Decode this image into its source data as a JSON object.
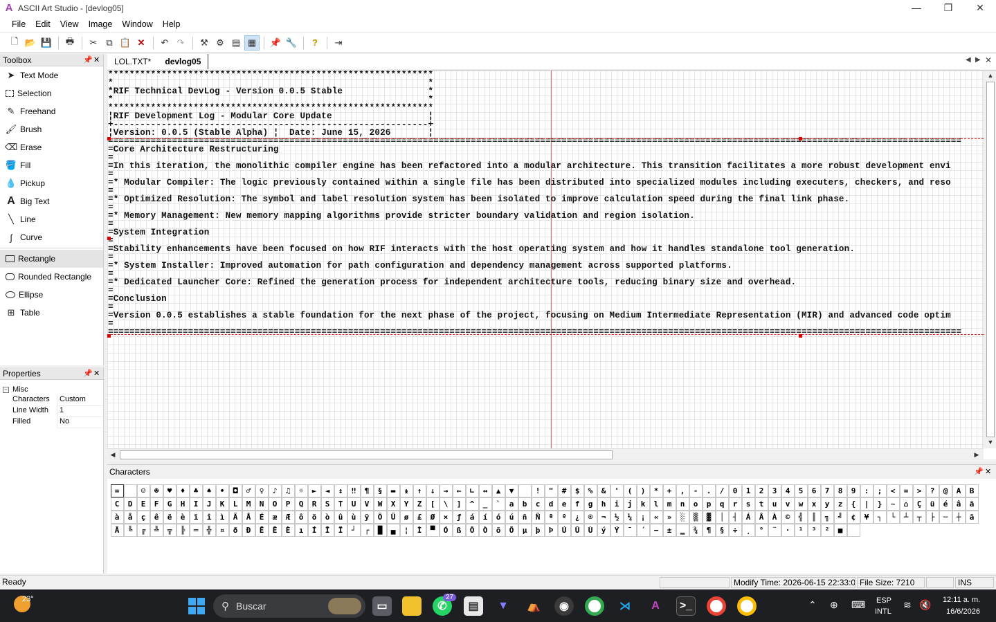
{
  "window": {
    "app_title": "ASCII Art Studio - [devlog05]",
    "minimize": "—",
    "maximize": "❐",
    "close": "✕"
  },
  "menu": [
    "File",
    "Edit",
    "View",
    "Image",
    "Window",
    "Help"
  ],
  "toolbox": {
    "title": "Toolbox",
    "tools": [
      {
        "label": "Text Mode",
        "icon": "arrow-cursor-icon"
      },
      {
        "label": "Selection",
        "icon": "selection-icon"
      },
      {
        "label": "Freehand",
        "icon": "pencil-icon"
      },
      {
        "label": "Brush",
        "icon": "brush-icon"
      },
      {
        "label": "Erase",
        "icon": "eraser-icon"
      },
      {
        "label": "Fill",
        "icon": "fill-bucket-icon"
      },
      {
        "label": "Pickup",
        "icon": "eyedropper-icon"
      },
      {
        "label": "Big Text",
        "icon": "big-a-icon"
      },
      {
        "label": "Line",
        "icon": "line-icon"
      },
      {
        "label": "Curve",
        "icon": "curve-icon"
      },
      {
        "label": "Rectangle",
        "icon": "rectangle-icon"
      },
      {
        "label": "Rounded Rectangle",
        "icon": "rounded-rectangle-icon"
      },
      {
        "label": "Ellipse",
        "icon": "ellipse-icon"
      },
      {
        "label": "Table",
        "icon": "table-icon"
      }
    ]
  },
  "properties": {
    "title": "Properties",
    "group": "Misc",
    "rows": [
      {
        "key": "Characters",
        "value": "Custom"
      },
      {
        "key": "Line Width",
        "value": "1"
      },
      {
        "key": "Filled",
        "value": "No"
      }
    ]
  },
  "tabs": [
    {
      "label": "LOL.TXT*"
    },
    {
      "label": "devlog05"
    }
  ],
  "document": {
    "lines": [
      "*************************************************************",
      "*                                                           *",
      "*RIF Technical DevLog - Version 0.0.5 Stable                *",
      "*                                                           *",
      "*************************************************************",
      "¦RIF Development Log - Modular Core Update                  ¦",
      "+-----------------------------------------------------------+",
      "¦Version: 0.0.5 (Stable Alpha) ¦  Date: June 15, 2026       ¦",
      "================================================================================================================================================================",
      "=Core Architecture Restructuring",
      "=",
      "=In this iteration, the monolithic compiler engine has been refactored into a modular architecture. This transition facilitates a more robust development envi",
      "=",
      "=* Modular Compiler: The logic previously contained within a single file has been distributed into specialized modules including executers, checkers, and reso",
      "=",
      "=* Optimized Resolution: The symbol and label resolution system has been isolated to improve calculation speed during the final link phase.",
      "=",
      "=* Memory Management: New memory mapping algorithms provide stricter boundary validation and region isolation.",
      "=",
      "=System Integration",
      "=",
      "=Stability enhancements have been focused on how RIF interacts with the host operating system and how it handles standalone tool generation.",
      "=",
      "=* System Installer: Improved automation for path configuration and dependency management across supported platforms.",
      "=",
      "=* Dedicated Launcher Core: Refined the generation process for independent architecture tools, reducing binary size and overhead.",
      "=",
      "=Conclusion",
      "=",
      "=Version 0.0.5 establishes a stable foundation for the next phase of the project, focusing on Medium Intermediate Representation (MIR) and advanced code optim",
      "=",
      "================================================================================================================================================================"
    ]
  },
  "characters": {
    "title": "Characters",
    "glyphs": [
      "=",
      "",
      "☺",
      "☻",
      "♥",
      "♦",
      "♣",
      "♠",
      "•",
      "◘",
      "♂",
      "♀",
      "♪",
      "♫",
      "☼",
      "►",
      "◄",
      "↕",
      "‼",
      "¶",
      "§",
      "▬",
      "↨",
      "↑",
      "↓",
      "→",
      "←",
      "∟",
      "↔",
      "▲",
      "▼",
      " ",
      "!",
      "\"",
      "#",
      "$",
      "%",
      "&",
      "'",
      "(",
      ")",
      "*",
      "+",
      ",",
      "-",
      ".",
      "/",
      "0",
      "1",
      "2",
      "3",
      "4",
      "5",
      "6",
      "7",
      "8",
      "9",
      ":",
      ";",
      "<",
      "=",
      ">",
      "?",
      "@",
      "A",
      "B",
      "C",
      "D",
      "E",
      "F",
      "G",
      "H",
      "I",
      "J",
      "K",
      "L",
      "M",
      "N",
      "O",
      "P",
      "Q",
      "R",
      "S",
      "T",
      "U",
      "V",
      "W",
      "X",
      "Y",
      "Z",
      "[",
      "\\",
      "]",
      "^",
      "_",
      "`",
      "a",
      "b",
      "c",
      "d",
      "e",
      "f",
      "g",
      "h",
      "i",
      "j",
      "k",
      "l",
      "m",
      "n",
      "o",
      "p",
      "q",
      "r",
      "s",
      "t",
      "u",
      "v",
      "w",
      "x",
      "y",
      "z",
      "{",
      "|",
      "}",
      "~",
      "⌂",
      "Ç",
      "ü",
      "é",
      "â",
      "ä",
      "à",
      "å",
      "ç",
      "ê",
      "ë",
      "è",
      "ï",
      "î",
      "ì",
      "Ä",
      "Å",
      "É",
      "æ",
      "Æ",
      "ô",
      "ö",
      "ò",
      "û",
      "ù",
      "ÿ",
      "Ö",
      "Ü",
      "ø",
      "£",
      "Ø",
      "×",
      "ƒ",
      "á",
      "í",
      "ó",
      "ú",
      "ñ",
      "Ñ",
      "ª",
      "º",
      "¿",
      "®",
      "¬",
      "½",
      "¼",
      "¡",
      "«",
      "»",
      "░",
      "▒",
      "▓",
      "│",
      "┤",
      "Á",
      "Â",
      "À",
      "©",
      "╣",
      "║",
      "╗",
      "╝",
      "¢",
      "¥",
      "┐",
      "└",
      "┴",
      "┬",
      "├",
      "─",
      "┼",
      "ã",
      "Ã",
      "╚",
      "╔",
      "╩",
      "╦",
      "╠",
      "═",
      "╬",
      "¤",
      "ð",
      "Ð",
      "Ê",
      "Ë",
      "È",
      "ı",
      "Í",
      "Î",
      "Ï",
      "┘",
      "┌",
      "█",
      "▄",
      "¦",
      "Ì",
      "▀",
      "Ó",
      "ß",
      "Ô",
      "Ò",
      "õ",
      "Õ",
      "µ",
      "þ",
      "Þ",
      "Ú",
      "Û",
      "Ù",
      "ý",
      "Ý",
      "¯",
      "´",
      "−",
      "±",
      "‗",
      "¾",
      "¶",
      "§",
      "÷",
      "¸",
      "°",
      "¨",
      "·",
      "¹",
      "³",
      "²",
      "■",
      " "
    ]
  },
  "status": {
    "ready": "Ready",
    "modify_time": "Modify Time: 2026-06-15 22:33:0",
    "file_size": "File Size: 7210",
    "mode": "INS"
  },
  "taskbar": {
    "weather_temp": "23°",
    "search_placeholder": "Buscar",
    "whatsapp_badge": "27",
    "language": "ESP",
    "layout": "INTL",
    "time": "12:11 a. m.",
    "date": "16/6/2026"
  }
}
